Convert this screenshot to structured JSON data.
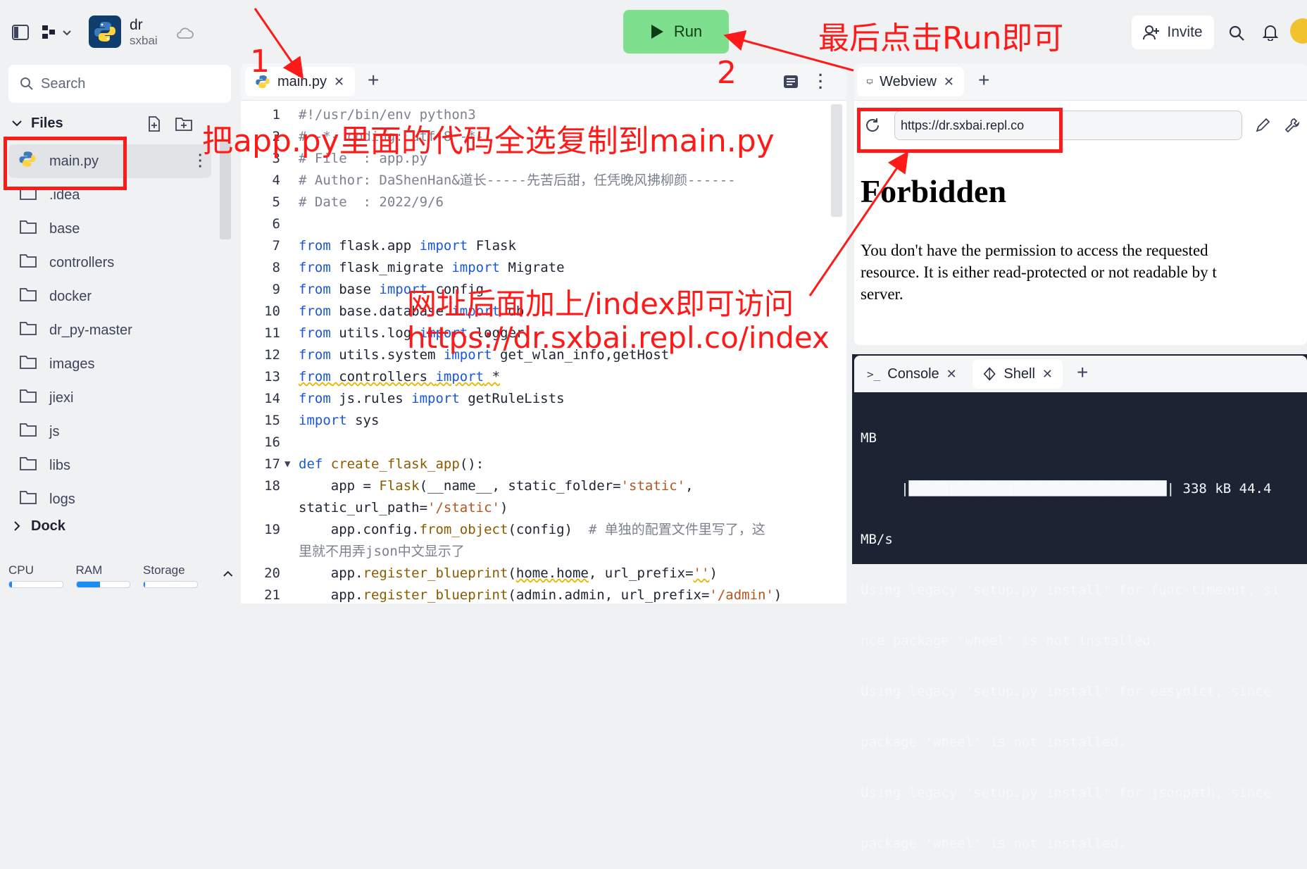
{
  "topbar": {
    "repl_name": "dr",
    "repl_owner": "sxbai",
    "run_label": "Run",
    "invite_label": "Invite"
  },
  "sidebar": {
    "search_placeholder": "Search",
    "files_label": "Files",
    "items": [
      {
        "label": "main.py",
        "type": "python"
      },
      {
        "label": ".idea",
        "type": "folder"
      },
      {
        "label": "base",
        "type": "folder"
      },
      {
        "label": "controllers",
        "type": "folder"
      },
      {
        "label": "docker",
        "type": "folder"
      },
      {
        "label": "dr_py-master",
        "type": "folder"
      },
      {
        "label": "images",
        "type": "folder"
      },
      {
        "label": "jiexi",
        "type": "folder"
      },
      {
        "label": "js",
        "type": "folder"
      },
      {
        "label": "libs",
        "type": "folder"
      },
      {
        "label": "logs",
        "type": "folder"
      }
    ],
    "dock_label": "Dock",
    "stats": {
      "cpu_label": "CPU",
      "ram_label": "RAM",
      "storage_label": "Storage",
      "cpu_level": 0.05,
      "ram_level": 0.45,
      "storage_level": 0.03
    }
  },
  "editor": {
    "tab_label": "main.py",
    "line_numbers": [
      "1",
      "2",
      "3",
      "4",
      "5",
      "6",
      "7",
      "8",
      "9",
      "10",
      "11",
      "12",
      "13",
      "14",
      "15",
      "16",
      "17",
      "18",
      "",
      "19",
      "",
      "20",
      "21"
    ]
  },
  "webview": {
    "tab_label": "Webview",
    "url": "https://dr.sxbai.repl.co",
    "heading": "Forbidden",
    "message_lines": [
      "You don't have the permission to access the requested",
      "resource. It is either read-protected or not readable by t",
      "server."
    ]
  },
  "console": {
    "console_tab": "Console",
    "shell_tab": "Shell",
    "lines": [
      "MB",
      "     |████████████████████████████████| 338 kB 44.4",
      "MB/s",
      "Using legacy 'setup.py install' for func-timeout, si",
      "nce package 'wheel' is not installed.",
      "Using legacy 'setup.py install' for easydict, since",
      "package 'wheel' is not installed.",
      "Using legacy 'setup.py install' for jsonpath, since",
      "package 'wheel' is not installed."
    ]
  },
  "annotations": {
    "step1": "1",
    "step2": "2",
    "run_note": "最后点击Run即可",
    "copy_note": "把app.py里面的代码全选复制到main.py",
    "url_note": "网址后面加上/index即可访问",
    "url_example": "https://dr.sxbai.repl.co/index"
  },
  "colors": {
    "run_button": "#7ee08f",
    "annotation_red": "#ff1a1a",
    "console_bg": "#1c2333",
    "keyword_blue": "#1a57d6"
  }
}
